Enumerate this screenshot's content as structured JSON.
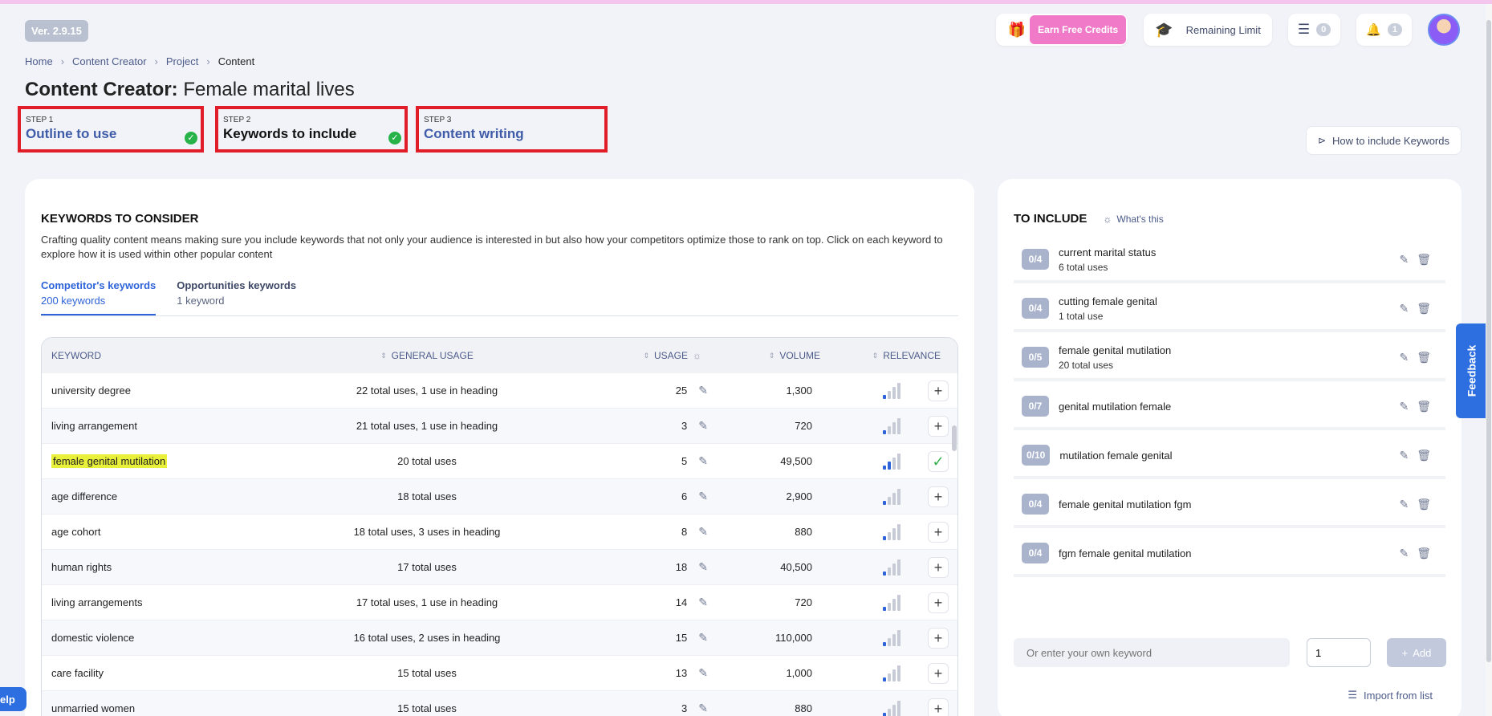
{
  "version": "Ver. 2.9.15",
  "topbar": {
    "earn_credits": "Earn Free Credits",
    "remaining_limit": "Remaining Limit",
    "list_count": "0",
    "notif_count": "1"
  },
  "breadcrumb": [
    "Home",
    "Content Creator",
    "Project",
    "Content"
  ],
  "page_title": {
    "prefix": "Content Creator:",
    "name": "Female marital lives"
  },
  "steps": [
    {
      "label": "STEP 1",
      "name": "Outline to use"
    },
    {
      "label": "STEP 2",
      "name": "Keywords to include"
    },
    {
      "label": "STEP 3",
      "name": "Content writing"
    }
  ],
  "how_to_btn": "How to include Keywords",
  "left": {
    "title": "KEYWORDS TO CONSIDER",
    "description": "Crafting quality content means making sure you include keywords that not only your audience is interested in but also how your competitors optimize those to rank on top. Click on each keyword to explore how it is used within other popular content",
    "tabs": [
      {
        "title": "Competitor's keywords",
        "sub": "200 keywords"
      },
      {
        "title": "Opportunities keywords",
        "sub": "1 keyword"
      }
    ],
    "columns": [
      "KEYWORD",
      "GENERAL USAGE",
      "USAGE",
      "VOLUME",
      "RELEVANCE"
    ],
    "rows": [
      {
        "keyword": "university degree",
        "general": "22 total uses, 1 use in heading",
        "usage": "25",
        "volume": "1,300"
      },
      {
        "keyword": "living arrangement",
        "general": "21 total uses, 1 use in heading",
        "usage": "3",
        "volume": "720"
      },
      {
        "keyword": "female genital mutilation",
        "general": "20 total uses",
        "usage": "5",
        "volume": "49,500"
      },
      {
        "keyword": "age difference",
        "general": "18 total uses",
        "usage": "6",
        "volume": "2,900"
      },
      {
        "keyword": "age cohort",
        "general": "18 total uses, 3 uses in heading",
        "usage": "8",
        "volume": "880"
      },
      {
        "keyword": "human rights",
        "general": "17 total uses",
        "usage": "18",
        "volume": "40,500"
      },
      {
        "keyword": "living arrangements",
        "general": "17 total uses, 1 use in heading",
        "usage": "14",
        "volume": "720"
      },
      {
        "keyword": "domestic violence",
        "general": "16 total uses, 2 uses in heading",
        "usage": "15",
        "volume": "110,000"
      },
      {
        "keyword": "care facility",
        "general": "15 total uses",
        "usage": "13",
        "volume": "1,000"
      },
      {
        "keyword": "unmarried women",
        "general": "15 total uses",
        "usage": "3",
        "volume": "880"
      }
    ]
  },
  "right": {
    "title": "TO INCLUDE",
    "whats_this": "What's this",
    "items": [
      {
        "badge": "0/4",
        "name": "current marital status",
        "uses": "6 total uses"
      },
      {
        "badge": "0/4",
        "name": "cutting female genital",
        "uses": "1 total use"
      },
      {
        "badge": "0/5",
        "name": "female genital mutilation",
        "uses": "20 total uses"
      },
      {
        "badge": "0/7",
        "name": "genital mutilation female",
        "uses": ""
      },
      {
        "badge": "0/10",
        "name": "mutilation female genital",
        "uses": ""
      },
      {
        "badge": "0/4",
        "name": "female genital mutilation fgm",
        "uses": ""
      },
      {
        "badge": "0/4",
        "name": "fgm female genital mutilation",
        "uses": ""
      }
    ],
    "own_placeholder": "Or enter your own keyword",
    "qty_value": "1",
    "add_label": "Add",
    "import_label": "Import from list"
  },
  "feedback": "Feedback",
  "help": "elp"
}
